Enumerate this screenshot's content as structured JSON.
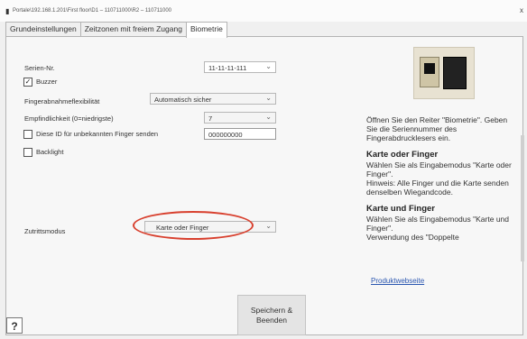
{
  "window": {
    "title": "Portale\\192.168.1.201\\First floor\\D1 – 110711000\\R2 – 110711000",
    "close": "x"
  },
  "tabs": [
    {
      "label": "Grundeinstellungen",
      "active": false
    },
    {
      "label": "Zeitzonen mit freiem Zugang",
      "active": false
    },
    {
      "label": "Biometrie",
      "active": true
    }
  ],
  "form": {
    "serial_label": "Serien-Nr.",
    "serial_value": "11-11-11-111",
    "buzzer_label": "Buzzer",
    "buzzer_checked": true,
    "capture_label": "Fingerabnahmeflexibilität",
    "capture_value": "Automatisch sicher",
    "sensitivity_label": "Empfindlichkeit (0=niedrigste)",
    "sensitivity_value": "7",
    "unknown_id_label": "Diese ID für unbekannten Finger senden",
    "unknown_id_value": "000000000",
    "backlight_label": "Backlight",
    "access_mode_label": "Zutrittsmodus",
    "access_mode_value": "Karte oder Finger"
  },
  "buttons": {
    "help": "?",
    "save": "Speichern & Beenden"
  },
  "help_panel": {
    "intro": "Öffnen Sie den Reiter \"Biometrie\". Geben Sie die Seriennummer des Fingerabdrucklesers ein.",
    "section1_title": "Karte oder Finger",
    "section1_text": "Wählen Sie als Eingabemodus \"Karte oder Finger\".",
    "section1_note": "Hinweis: Alle Finger und die Karte senden denselben Wiegandcode.",
    "section2_title": "Karte und Finger",
    "section2_text": "Wählen Sie als Eingabemodus \"Karte und Finger\".",
    "section2_note": "Verwendung des \"Doppelte",
    "link": "Produktwebseite"
  },
  "colors": {
    "highlight_oval": "#d8402e",
    "link": "#2a56b0"
  }
}
